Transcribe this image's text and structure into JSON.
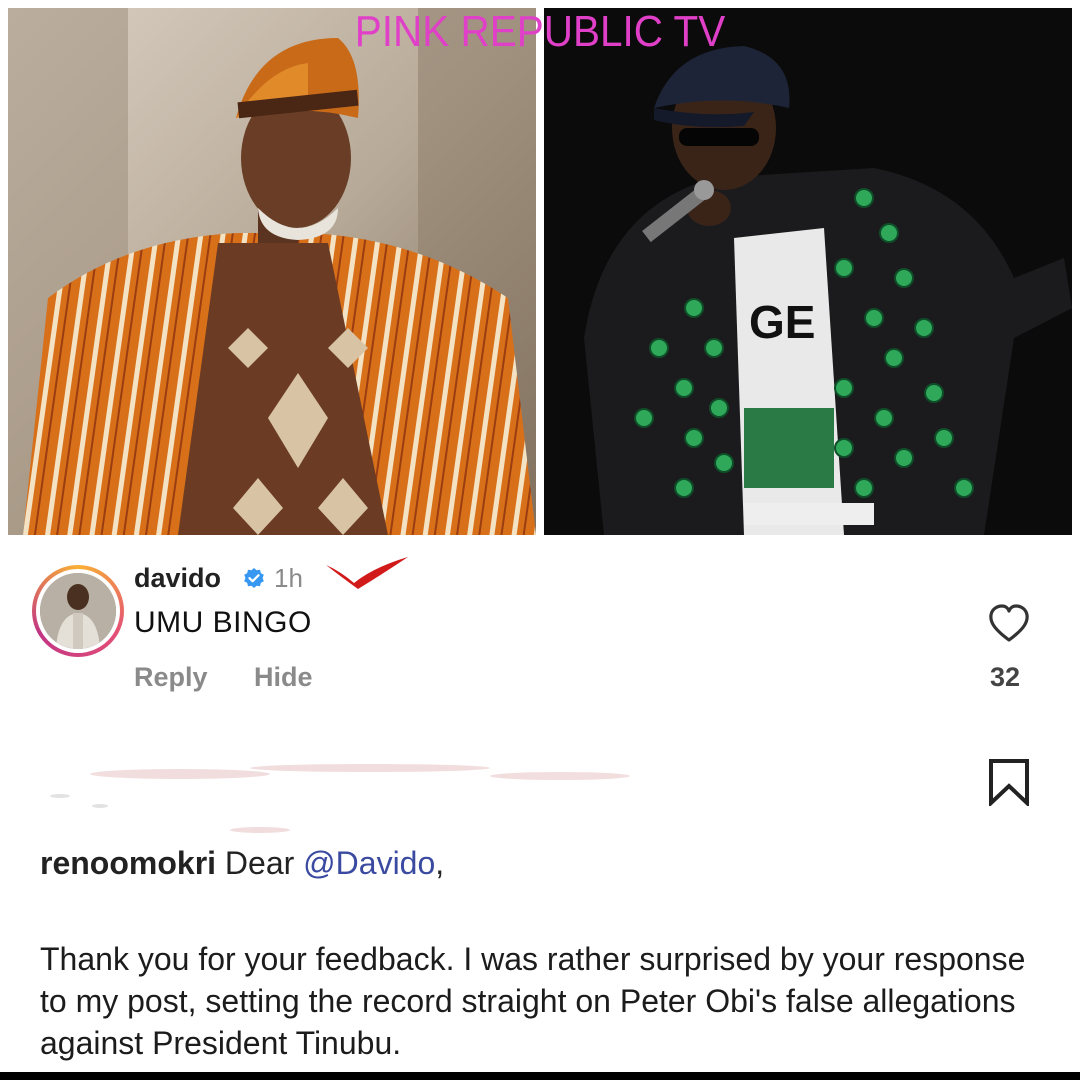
{
  "watermark": "PINK REPUBLIC TV",
  "comment": {
    "username": "davido",
    "verified": true,
    "time": "1h",
    "text": "UMU BINGO",
    "reply_label": "Reply",
    "hide_label": "Hide",
    "like_count": "32"
  },
  "caption": {
    "username": "renoomokri",
    "greeting_prefix": "Dear ",
    "mention": "@Davido",
    "greeting_suffix": ",",
    "body": "Thank you for your feedback. I was rather surprised by your response to my post, setting the record straight on Peter Obi's false allegations against President Tinubu."
  },
  "colors": {
    "watermark": "#e040c8",
    "verified": "#3897f0",
    "mention": "#3a4aa0",
    "red_mark": "#d11a1a"
  },
  "icons": [
    "verified-badge-icon",
    "heart-icon",
    "bookmark-icon"
  ]
}
